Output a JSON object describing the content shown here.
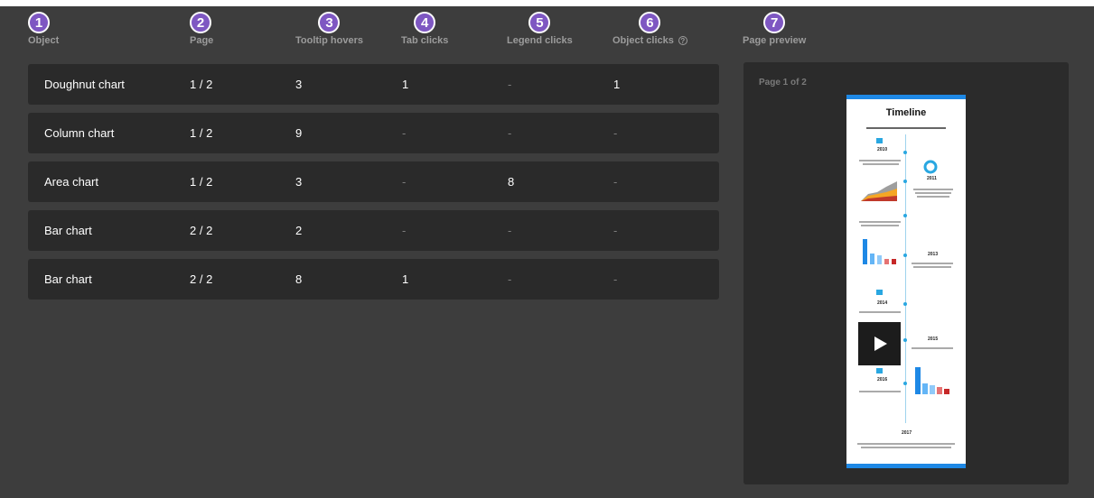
{
  "columns": [
    {
      "num": "1",
      "label": "Object"
    },
    {
      "num": "2",
      "label": "Page"
    },
    {
      "num": "3",
      "label": "Tooltip hovers"
    },
    {
      "num": "4",
      "label": "Tab clicks"
    },
    {
      "num": "5",
      "label": "Legend clicks"
    },
    {
      "num": "6",
      "label": "Object clicks"
    },
    {
      "num": "7",
      "label": "Page preview"
    }
  ],
  "help_icon": "?",
  "rows": [
    {
      "object": "Doughnut chart",
      "page": "1 / 2",
      "tooltip": "3",
      "tab": "1",
      "legend": "-",
      "clicks": "1"
    },
    {
      "object": "Column chart",
      "page": "1 / 2",
      "tooltip": "9",
      "tab": "-",
      "legend": "-",
      "clicks": "-"
    },
    {
      "object": "Area chart",
      "page": "1 / 2",
      "tooltip": "3",
      "tab": "-",
      "legend": "8",
      "clicks": "-"
    },
    {
      "object": "Bar chart",
      "page": "2 / 2",
      "tooltip": "2",
      "tab": "-",
      "legend": "-",
      "clicks": "-"
    },
    {
      "object": "Bar chart",
      "page": "2 / 2",
      "tooltip": "8",
      "tab": "1",
      "legend": "-",
      "clicks": "-"
    }
  ],
  "preview": {
    "page_label": "Page 1 of 2",
    "doc_title": "Timeline",
    "years": [
      "2010",
      "2011",
      "2013",
      "2014",
      "2015",
      "2016",
      "2017"
    ]
  },
  "colors": {
    "badge": "#7e57c2",
    "accent": "#1e88e5",
    "row_bg": "#2a2a2a",
    "page_bg": "#3d3d3d"
  }
}
